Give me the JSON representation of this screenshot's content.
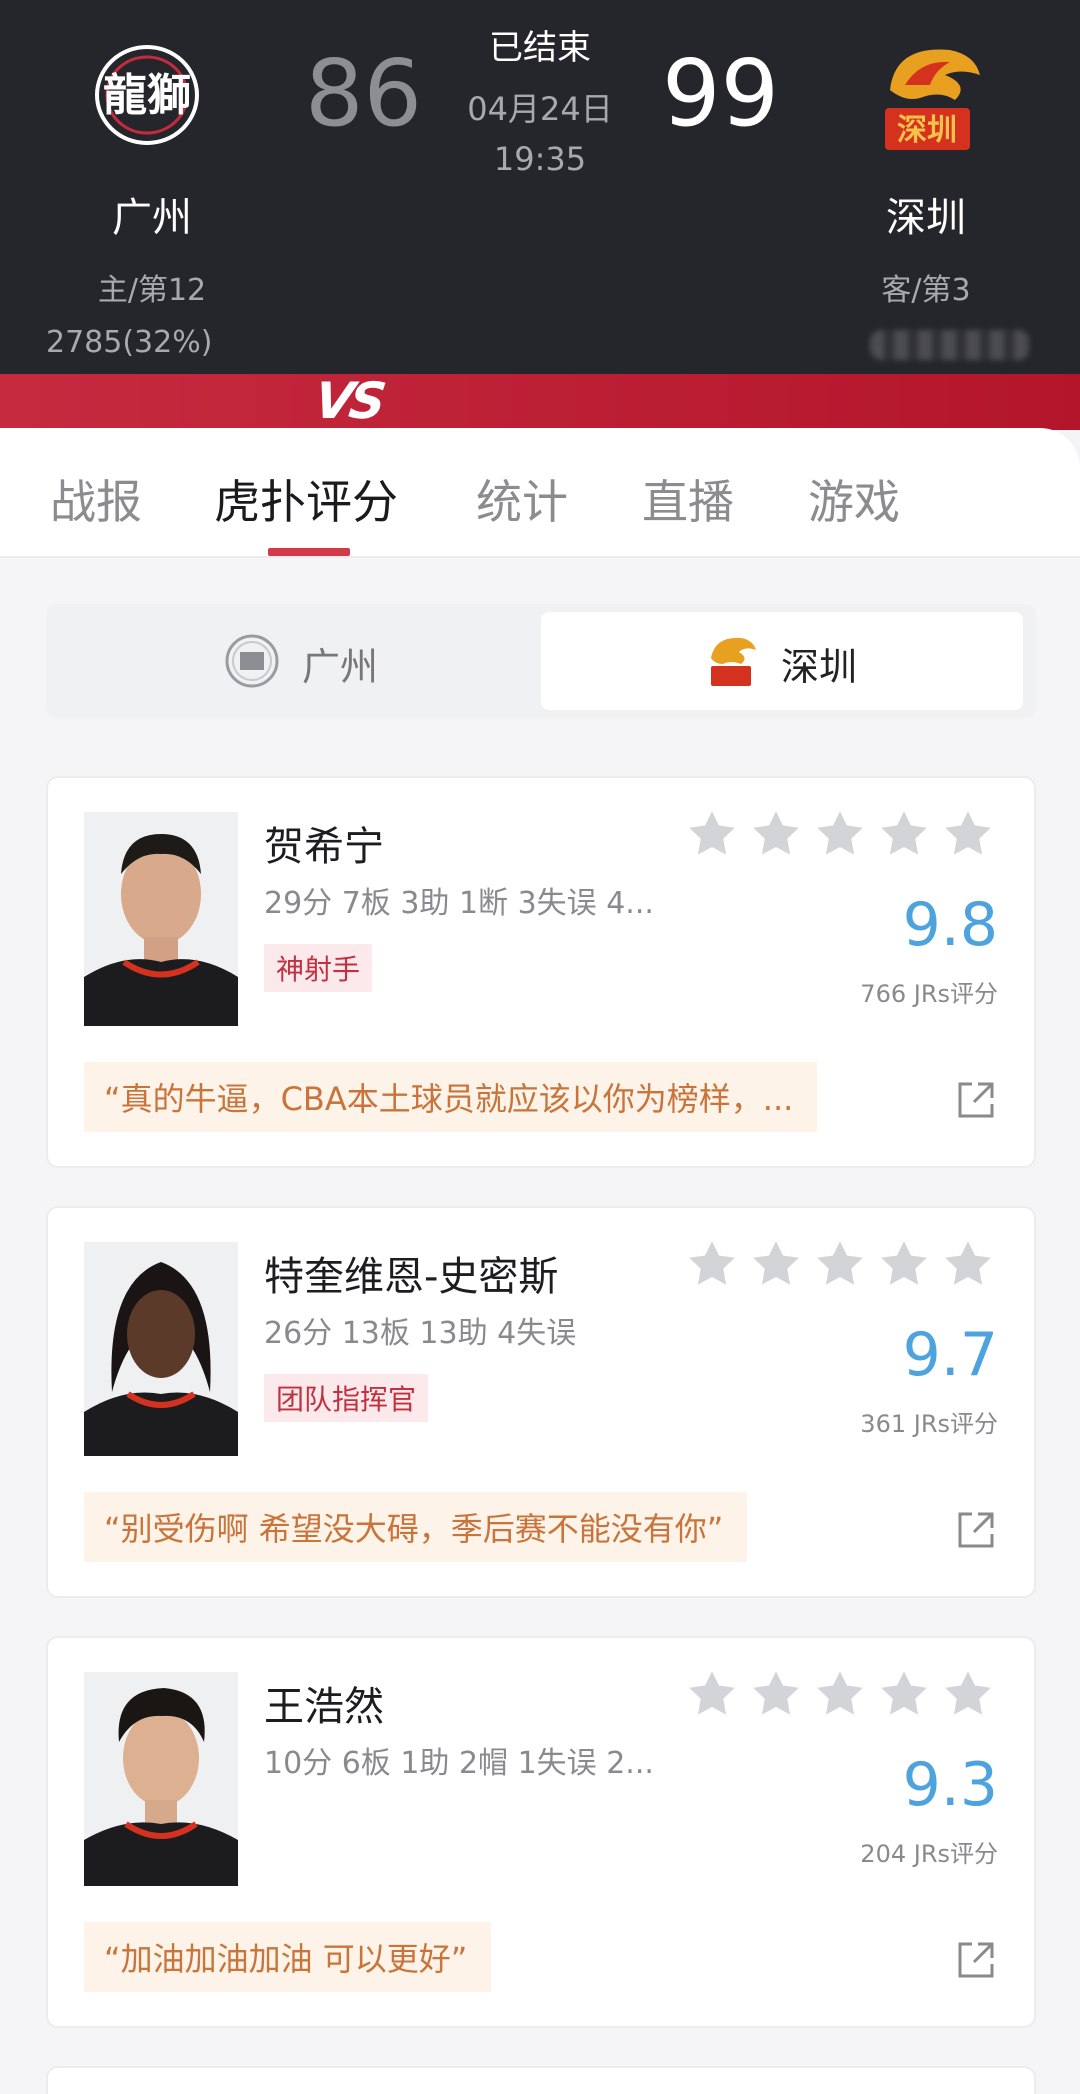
{
  "header": {
    "home": {
      "name": "广州",
      "rank": "主/第12",
      "support": "2785(32%)",
      "score": "86",
      "logo_text": "龍獅"
    },
    "away": {
      "name": "深圳",
      "rank": "客/第3",
      "score": "99",
      "logo_text": "深圳"
    },
    "status": "已结束",
    "date": "04月24日",
    "time": "19:35",
    "vs": "VS"
  },
  "tabs": [
    {
      "label": "战报"
    },
    {
      "label": "虎扑评分"
    },
    {
      "label": "统计"
    },
    {
      "label": "直播"
    },
    {
      "label": "游戏"
    }
  ],
  "team_switch": {
    "left": {
      "label": "广州"
    },
    "right": {
      "label": "深圳"
    }
  },
  "players": [
    {
      "name": "贺希宁",
      "stats": "29分 7板 3助 1断 3失误 4...",
      "tag": "神射手",
      "rating": "9.8",
      "rating_count": "766 JRs评分",
      "comment": "“真的牛逼，CBA本土球员就应该以你为榜样，..."
    },
    {
      "name": "特奎维恩-史密斯",
      "stats": "26分 13板 13助 4失误",
      "tag": "团队指挥官",
      "rating": "9.7",
      "rating_count": "361 JRs评分",
      "comment": "“别受伤啊 希望没大碍，季后赛不能没有你”"
    },
    {
      "name": "王浩然",
      "stats": "10分 6板 1助 2帽 1失误 2...",
      "tag": "",
      "rating": "9.3",
      "rating_count": "204 JRs评分",
      "comment": "“加油加油加油 可以更好”"
    }
  ],
  "colors": {
    "header_bg": "#25262b",
    "accent_red": "#d23a4a",
    "rating_blue": "#4da3dd",
    "comment_text": "#c8743a",
    "star_gray": "#d3d4d8"
  },
  "icons": [
    "star-icon",
    "share-icon",
    "guangzhou-logo",
    "shenzhen-logo"
  ]
}
